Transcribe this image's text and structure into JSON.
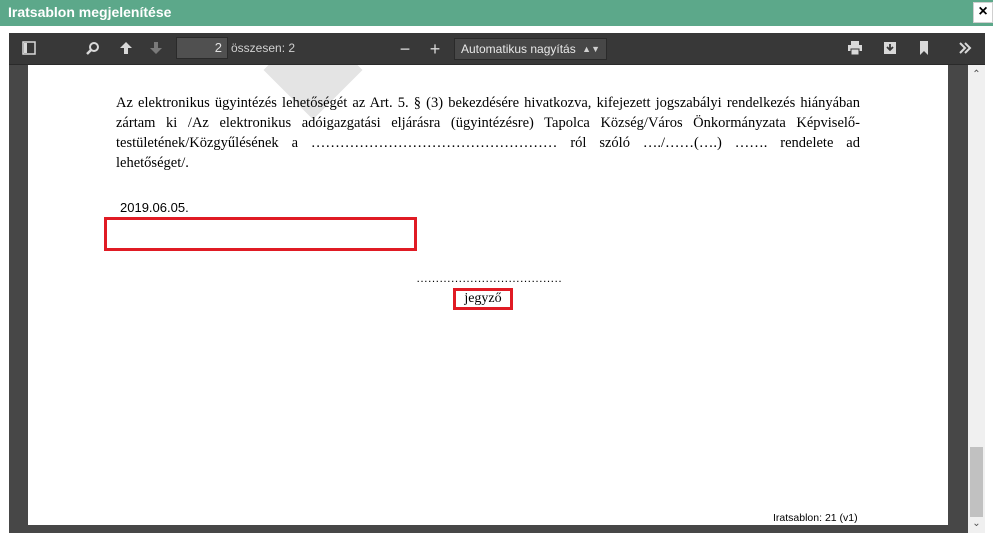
{
  "dialog": {
    "title": "Iratsablon megjelenítése",
    "close_label": "×"
  },
  "toolbar": {
    "page_number": "2",
    "page_total": "összesen: 2",
    "zoom_minus": "−",
    "zoom_plus": "+",
    "zoom_value": "Automatikus nagyítás",
    "icons": [
      "sidebar-toggle-icon",
      "search-icon",
      "previous-page-icon",
      "next-page-icon",
      "print-icon",
      "download-icon",
      "bookmark-icon",
      "tools-icon"
    ]
  },
  "document": {
    "paragraph": "Az elektronikus ügyintézés lehetőségét az Art. 5. § (3) bekezdésére hivatkozva, kifejezett jogszabályi rendelkezés hiányában zártam ki /Az elektronikus adóigazgatási eljárásra (ügyintézésre) Tapolca Község/Város Önkormányzata Képviselő-testületének/Közgyűlésének a …………………………………………… ról szóló …./……(….) ……. rendelete ad lehetőséget/.",
    "date": "2019.06.05.",
    "signature_dots": "………………………………………",
    "signature_label": "jegyző",
    "footer": "Iratsablon: 21 (v1)"
  },
  "colors": {
    "title_bar": "#5ca88a",
    "toolbar": "#383838",
    "highlight": "#e01b24"
  }
}
